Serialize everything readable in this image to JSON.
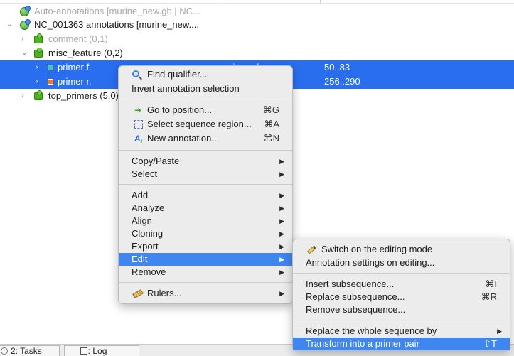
{
  "tree": {
    "rows": [
      {
        "label": "Auto-annotations [murine_new.gb | NC..."
      },
      {
        "label": "NC_001363 annotations [murine_new...."
      },
      {
        "label": "comment  (0,1)"
      },
      {
        "label": "misc_feature  (0,2)"
      },
      {
        "label": "primer f.",
        "col2": "primer_fw",
        "col3": "50..83"
      },
      {
        "label": "primer r.",
        "col3": "256..290"
      },
      {
        "label": "top_primers  (5,0)"
      }
    ]
  },
  "context_menu": {
    "items": [
      {
        "label": "Find qualifier...",
        "icon": "magnifier-icon"
      },
      {
        "label": "Invert annotation selection"
      },
      {
        "label": "Go to position...",
        "icon": "arrow-right-icon",
        "shortcut": "⌘G"
      },
      {
        "label": "Select sequence region...",
        "icon": "select-region-icon",
        "shortcut": "⌘A"
      },
      {
        "label": "New annotation...",
        "icon": "new-annotation-icon",
        "shortcut": "⌘N"
      },
      {
        "label": "Copy/Paste",
        "submenu": true
      },
      {
        "label": "Select",
        "submenu": true
      },
      {
        "label": "Add",
        "submenu": true
      },
      {
        "label": "Analyze",
        "submenu": true
      },
      {
        "label": "Align",
        "submenu": true
      },
      {
        "label": "Cloning",
        "submenu": true
      },
      {
        "label": "Export",
        "submenu": true
      },
      {
        "label": "Edit",
        "submenu": true,
        "highlighted": true
      },
      {
        "label": "Remove",
        "submenu": true
      },
      {
        "label": "Rulers...",
        "icon": "ruler-icon",
        "submenu": true
      }
    ]
  },
  "edit_submenu": {
    "items": [
      {
        "label": "Switch on the editing mode",
        "icon": "pencil-icon"
      },
      {
        "label": "Annotation settings on editing..."
      },
      {
        "label": "Insert subsequence...",
        "shortcut": "⌘I"
      },
      {
        "label": "Replace subsequence...",
        "shortcut": "⌘R"
      },
      {
        "label": "Remove subsequence..."
      },
      {
        "label": "Replace the whole sequence by",
        "submenu": true
      },
      {
        "label": "Transform into a primer pair",
        "shortcut": "⇧T",
        "highlighted": true
      }
    ]
  },
  "bottom_tabs": [
    {
      "label": "2: Tasks",
      "icon": "tasks-icon"
    },
    {
      "label": "3: Log",
      "icon": "log-icon"
    }
  ],
  "colors": {
    "selection": "#2a6ef0",
    "menu_highlight": "#3f86f0",
    "menu_background": "#ececec",
    "primer_f_marker": "#3cc5d0",
    "primer_r_marker": "#f07a2a",
    "group_icon": "#4fb320"
  }
}
